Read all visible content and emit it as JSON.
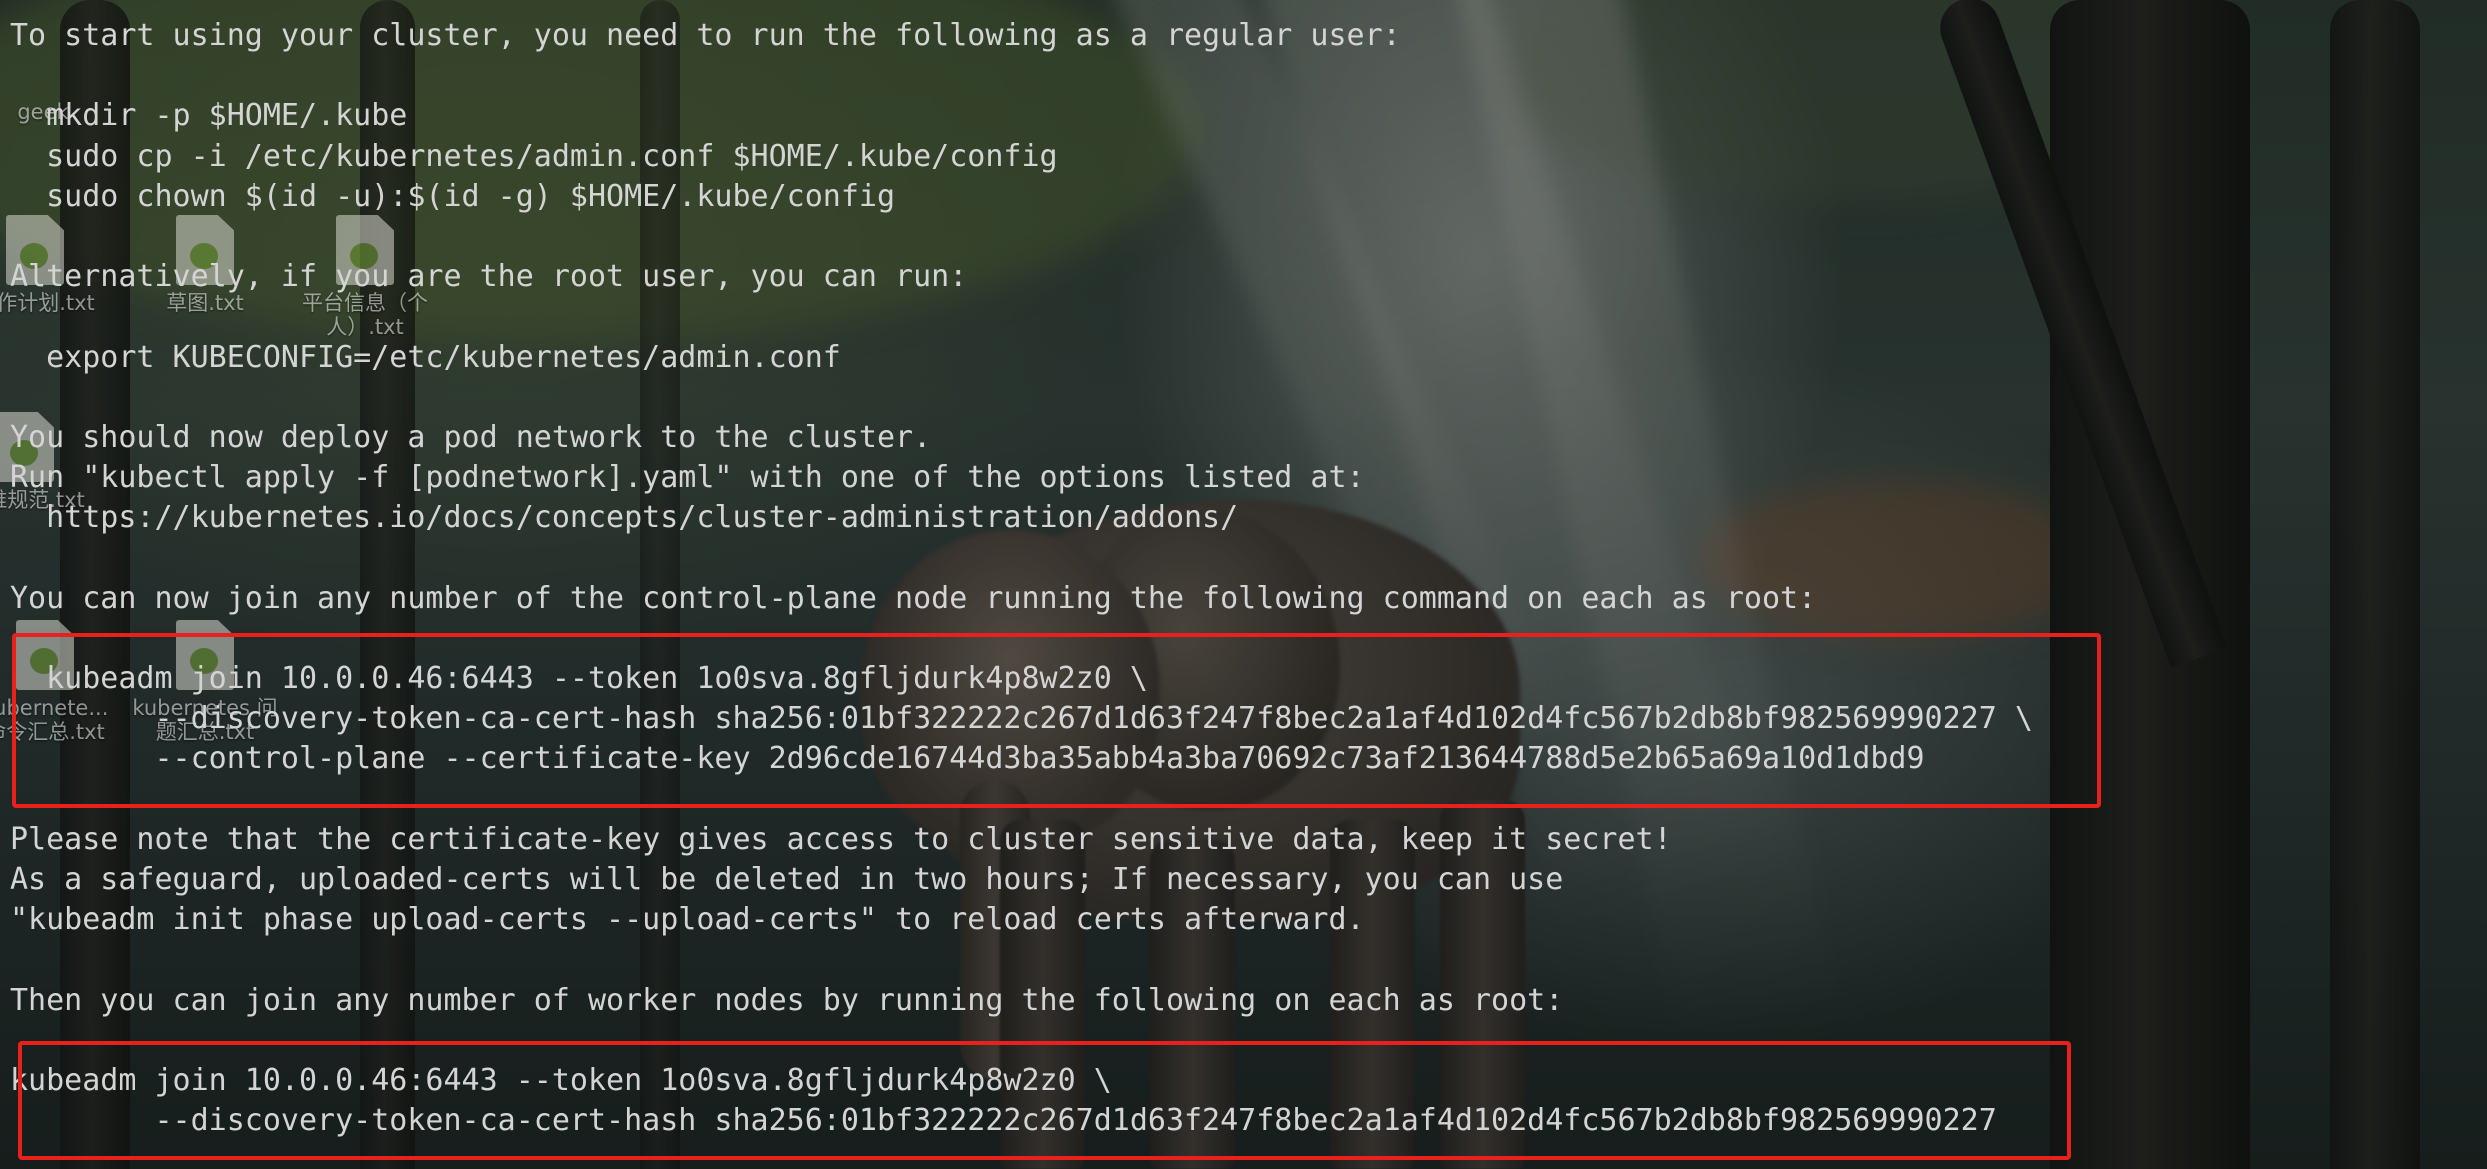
{
  "terminal": {
    "lines": [
      "To start using your cluster, you need to run the following as a regular user:",
      "",
      "  mkdir -p $HOME/.kube",
      "  sudo cp -i /etc/kubernetes/admin.conf $HOME/.kube/config",
      "  sudo chown $(id -u):$(id -g) $HOME/.kube/config",
      "",
      "Alternatively, if you are the root user, you can run:",
      "",
      "  export KUBECONFIG=/etc/kubernetes/admin.conf",
      "",
      "You should now deploy a pod network to the cluster.",
      "Run \"kubectl apply -f [podnetwork].yaml\" with one of the options listed at:",
      "  https://kubernetes.io/docs/concepts/cluster-administration/addons/",
      "",
      "You can now join any number of the control-plane node running the following command on each as root:",
      "",
      "  kubeadm join 10.0.0.46:6443 --token 1o0sva.8gfljdurk4p8w2z0 \\",
      "        --discovery-token-ca-cert-hash sha256:01bf322222c267d1d63f247f8bec2a1af4d102d4fc567b2db8bf982569990227 \\",
      "        --control-plane --certificate-key 2d96cde16744d3ba35abb4a3ba70692c73af213644788d5e2b65a69a10d1dbd9",
      "",
      "Please note that the certificate-key gives access to cluster sensitive data, keep it secret!",
      "As a safeguard, uploaded-certs will be deleted in two hours; If necessary, you can use",
      "\"kubeadm init phase upload-certs --upload-certs\" to reload certs afterward.",
      "",
      "Then you can join any number of worker nodes by running the following on each as root:",
      "",
      "kubeadm join 10.0.0.46:6443 --token 1o0sva.8gfljdurk4p8w2z0 \\",
      "        --discovery-token-ca-cert-hash sha256:01bf322222c267d1d63f247f8bec2a1af4d102d4fc567b2db8bf982569990227"
    ]
  },
  "desktop_icons": [
    {
      "label": "工作计划.txt"
    },
    {
      "label": "草图.txt"
    },
    {
      "label": "平台信息（个人）.txt"
    },
    {
      "label": "运维规范.txt"
    },
    {
      "label": "kubernete... 命令汇总.txt"
    },
    {
      "label": "kubernetes 问题汇总.txt"
    },
    {
      "label": "geek"
    }
  ],
  "colors": {
    "text": "#d4d4d4",
    "highlight_border": "#e8211c"
  }
}
